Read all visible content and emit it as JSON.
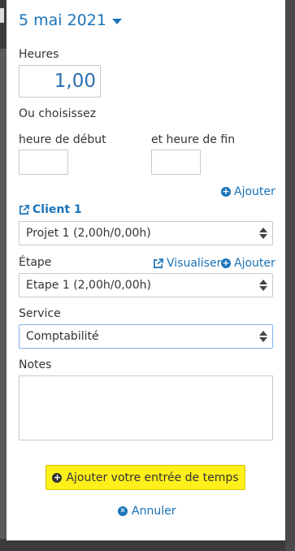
{
  "date_picker": {
    "label": "5 mai 2021"
  },
  "hours": {
    "label": "Heures",
    "value": "1,00"
  },
  "time_range": {
    "hint": "Ou choisissez",
    "start_label": "heure de début",
    "end_label": "et heure de fin",
    "start_value": "",
    "end_value": ""
  },
  "client": {
    "add_label": "Ajouter",
    "name": "Client 1",
    "project_selected": "Projet 1 (2,00h/0,00h)"
  },
  "stage": {
    "label": "Étape",
    "view_label": "Visualiser",
    "add_label": "Ajouter",
    "selected": "Etape 1 (2,00h/0,00h)"
  },
  "service": {
    "label": "Service",
    "selected": "Comptabilité"
  },
  "notes": {
    "label": "Notes",
    "value": ""
  },
  "actions": {
    "submit_label": "Ajouter votre entrée de temps",
    "cancel_label": "Annuler"
  },
  "colors": {
    "accent": "#1a73b8",
    "highlight": "#ffef1a"
  }
}
